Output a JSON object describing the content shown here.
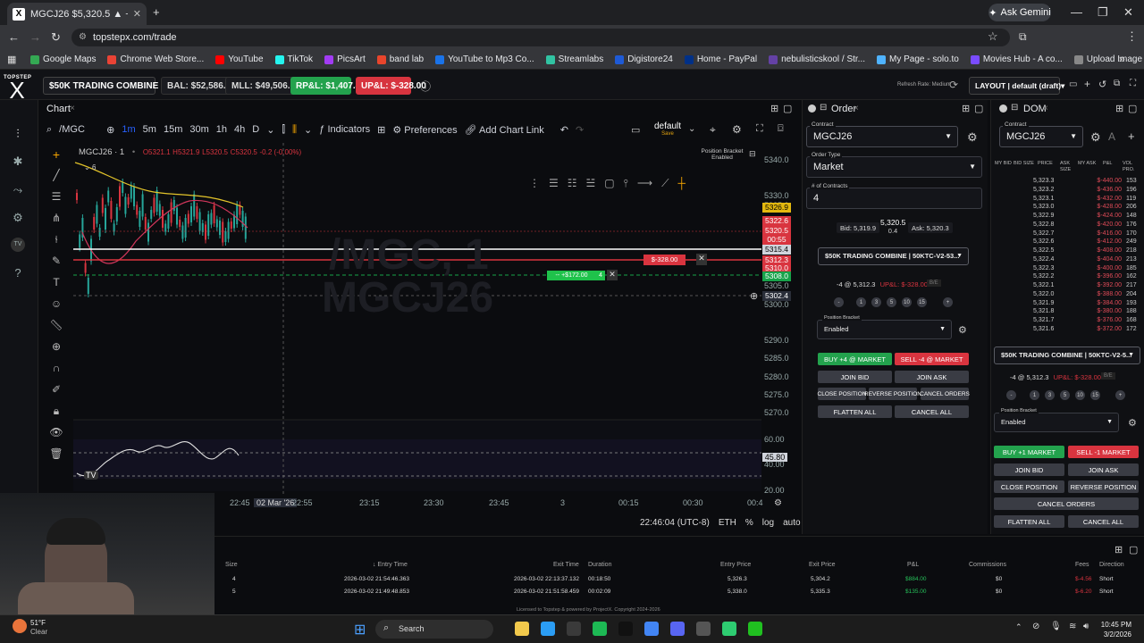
{
  "browser": {
    "tab_title": "MGCJ26 $5,320.5 ▲ +0.17%",
    "tab_favicon": "X",
    "ask_gemini": "Ask Gemini",
    "url": "topstepx.com/trade",
    "bookmarks": [
      {
        "label": "Google Maps",
        "color": "#34a853"
      },
      {
        "label": "Chrome Web Store...",
        "color": "#ea4335"
      },
      {
        "label": "YouTube",
        "color": "#ff0000"
      },
      {
        "label": "TikTok",
        "color": "#25f4ee"
      },
      {
        "label": "PicsArt",
        "color": "#a23cf4"
      },
      {
        "label": "band lab",
        "color": "#e8452c"
      },
      {
        "label": "YouTube to Mp3 Co...",
        "color": "#1a73e8"
      },
      {
        "label": "Streamlabs",
        "color": "#31c3a2"
      },
      {
        "label": "Digistore24",
        "color": "#1e5ad6"
      },
      {
        "label": "Home - PayPal",
        "color": "#003087"
      },
      {
        "label": "nebulisticskool / Str...",
        "color": "#6441a5"
      },
      {
        "label": "My Page - solo.to",
        "color": "#4fb3ff"
      },
      {
        "label": "Movies Hub - A co...",
        "color": "#7a4cff"
      },
      {
        "label": "Upload Image — re...",
        "color": "#888888"
      },
      {
        "label": "Active Ride Shop - I...",
        "color": "#ffffff"
      }
    ]
  },
  "header": {
    "logo_top": "TOPSTEP",
    "logo_x": "X",
    "account": "$50K TRADING COMBINE | 5...",
    "bal": "BAL: $52,586.21",
    "mll": "MLL: $49,506.75",
    "rpl": "RP&L: $1,407.46",
    "upl": "UP&L: $-328.00",
    "refresh": "Refresh Rate: Medium",
    "layout": "LAYOUT | default (draft)"
  },
  "chart": {
    "title": "Chart",
    "symbol": "/MGC",
    "timeframes": [
      "1m",
      "5m",
      "15m",
      "30m",
      "1h",
      "4h",
      "D"
    ],
    "indicators": "Indicators",
    "preferences": "Preferences",
    "add_link": "Add Chart Link",
    "template": "default",
    "template_sub": "Save",
    "legend_symbol": "MGCJ26 · 1",
    "legend_count": "6",
    "ohlc": {
      "o": "O5321.1",
      "h": "H5321.9",
      "l": "L5320.5",
      "c": "C5320.5",
      "chg": "-0.2 (-0.00%)"
    },
    "watermark_1": "/MGC, 1",
    "watermark_2": "MGCJ26",
    "position_bracket": "Position Bracket",
    "position_bracket_state": "Enabled",
    "pnl_tag": "$-328.00",
    "tp_tag": "+$172.00",
    "tp_qty": "4",
    "y_labels": [
      "5340.0",
      "5330.0",
      "5325.0",
      "5320.0",
      "5315.0",
      "5310.0",
      "5305.0",
      "5300.0",
      "5290.0",
      "5285.0",
      "5280.0",
      "5275.0",
      "5270.0"
    ],
    "y_tags": [
      {
        "text": "5326.9",
        "bg": "#e3b80f"
      },
      {
        "text": "5322.6",
        "bg": "#d9343f"
      },
      {
        "text": "5320.5",
        "bg": "#d9343f"
      },
      {
        "text": "00:55",
        "bg": "#d9343f"
      },
      {
        "text": "5315.4",
        "bg": "#d1d4dc"
      },
      {
        "text": "5312.3",
        "bg": "#d9343f"
      },
      {
        "text": "5310.0",
        "bg": "#d9343f"
      },
      {
        "text": "5308.0",
        "bg": "#17a34a"
      },
      {
        "text": "5302.4",
        "bg": "#2a2e39"
      }
    ],
    "osc_labels": [
      "60.00",
      "45.80",
      "40.00",
      "20.00"
    ],
    "x_labels": [
      "22:45",
      "02 Mar '26",
      "22:55",
      "23:15",
      "23:30",
      "23:45",
      "3",
      "00:15",
      "00:30",
      "00:4"
    ],
    "clock": "22:46:04 (UTC-8)",
    "session": "ETH",
    "pct": "%",
    "log": "log",
    "auto": "auto"
  },
  "order": {
    "title": "Order",
    "contract_label": "Contract",
    "contract": "MGCJ26",
    "type_label": "Order Type",
    "type": "Market",
    "qty_label": "# of Contracts",
    "qty": "4",
    "bid": "Bid: 5,319.9",
    "last": "5,320.5",
    "spread": "0.4",
    "ask": "Ask: 5,320.3",
    "account": "$50K TRADING COMBINE | 50KTC-V2-53...",
    "position": "-4 @ 5,312.3",
    "upl": "UP&L: $-328.00",
    "be": "B/E",
    "sizes": [
      "1",
      "3",
      "5",
      "10",
      "15"
    ],
    "bracket_label": "Position Bracket",
    "bracket": "Enabled",
    "buy": "BUY +4 @ MARKET",
    "sell": "SELL -4 @ MARKET",
    "join_bid": "JOIN BID",
    "join_ask": "JOIN ASK",
    "close": "CLOSE POSITION",
    "reverse": "REVERSE POSITION",
    "cancel_orders": "CANCEL ORDERS",
    "flatten": "FLATTEN ALL",
    "cancel_all": "CANCEL ALL"
  },
  "dom": {
    "title": "DOM",
    "contract_label": "Contract",
    "contract": "MGCJ26",
    "cols": [
      "MY BID",
      "BID SIZE",
      "PRICE",
      "ASK SIZE",
      "MY ASK",
      "P&L",
      "VOL PRO."
    ],
    "rows": [
      [
        "5,323.3",
        "$-440.00",
        "153"
      ],
      [
        "5,323.2",
        "$-436.00",
        "196"
      ],
      [
        "5,323.1",
        "$-432.00",
        "119"
      ],
      [
        "5,323.0",
        "$-428.00",
        "206"
      ],
      [
        "5,322.9",
        "$-424.00",
        "148"
      ],
      [
        "5,322.8",
        "$-420.00",
        "176"
      ],
      [
        "5,322.7",
        "$-416.00",
        "170"
      ],
      [
        "5,322.6",
        "$-412.00",
        "249"
      ],
      [
        "5,322.5",
        "$-408.00",
        "218"
      ],
      [
        "5,322.4",
        "$-404.00",
        "213"
      ],
      [
        "5,322.3",
        "$-400.00",
        "185"
      ],
      [
        "5,322.2",
        "$-396.00",
        "162"
      ],
      [
        "5,322.1",
        "$-392.00",
        "217"
      ],
      [
        "5,322.0",
        "$-388.00",
        "204"
      ],
      [
        "5,321.9",
        "$-384.00",
        "193"
      ],
      [
        "5,321.8",
        "$-380.00",
        "188"
      ],
      [
        "5,321.7",
        "$-376.00",
        "168"
      ],
      [
        "5,321.6",
        "$-372.00",
        "172"
      ]
    ],
    "account": "$50K TRADING COMBINE | 50KTC-V2-5...",
    "position": "-4 @ 5,312.3",
    "upl": "UP&L: $-328.00",
    "be": "B/E",
    "sizes": [
      "1",
      "3",
      "5",
      "10",
      "15"
    ],
    "bracket_label": "Position Bracket",
    "bracket": "Enabled",
    "buy": "BUY +1 MARKET",
    "sell": "SELL -1 MARKET",
    "join_bid": "JOIN BID",
    "join_ask": "JOIN ASK",
    "close": "CLOSE POSITION",
    "reverse": "REVERSE POSITION",
    "cancel_orders": "CANCEL ORDERS",
    "flatten": "FLATTEN ALL",
    "cancel_all": "CANCEL ALL"
  },
  "trades": {
    "headers": [
      "Size",
      "Entry Time",
      "Exit Time",
      "Duration",
      "Entry Price",
      "Exit Price",
      "P&L",
      "Commissions",
      "Fees",
      "Direction"
    ],
    "rows": [
      [
        "4",
        "2026-03-02 21:54:46.363",
        "2026-03-02 22:13:37.132",
        "00:18:50",
        "5,326.3",
        "5,304.2",
        "$884.00",
        "$0",
        "$-4.56",
        "Short"
      ],
      [
        "5",
        "2026-03-02 21:49:48.853",
        "2026-03-02 21:51:58.459",
        "00:02:09",
        "5,338.0",
        "5,335.3",
        "$135.00",
        "$0",
        "$-6.20",
        "Short"
      ]
    ],
    "footer": "Licensed to Topstep & powered by ProjectX. Copyright 2024-2026"
  },
  "taskbar": {
    "weather_temp": "51°F",
    "weather_desc": "Clear",
    "search": "Search",
    "time": "10:45 PM",
    "date": "3/2/2026"
  }
}
